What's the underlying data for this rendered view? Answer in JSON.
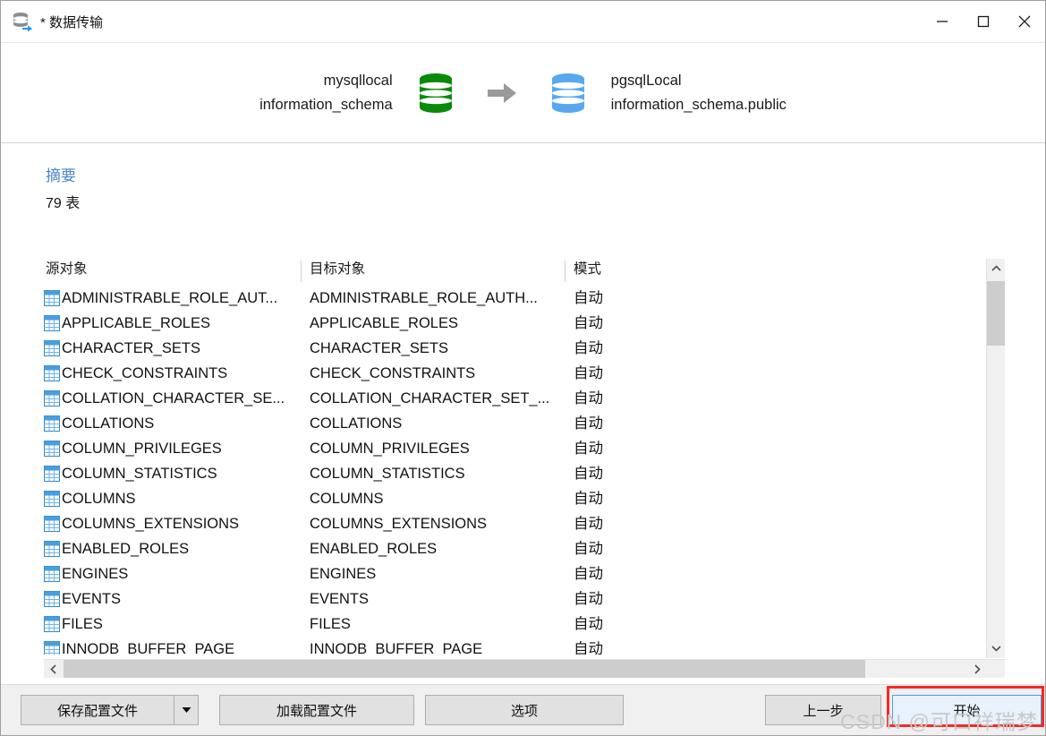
{
  "window": {
    "title": "* 数据传输",
    "icon": "database-transfer-icon",
    "controls": {
      "minimize": "minimize-icon",
      "maximize": "maximize-icon",
      "close": "close-icon"
    }
  },
  "transfer": {
    "source": {
      "connection": "mysqllocal",
      "schema": "information_schema",
      "icon": "database-green-icon",
      "color": "#0a8a0a"
    },
    "arrow": "arrow-right-icon",
    "target": {
      "connection": "pgsqlLocal",
      "schema": "information_schema.public",
      "icon": "database-blue-icon",
      "color": "#58a8f0"
    }
  },
  "summary": {
    "title": "摘要",
    "title_color": "#4a86c8",
    "count": "79 表"
  },
  "table": {
    "columns": [
      "源对象",
      "目标对象",
      "模式"
    ],
    "rows": [
      {
        "source": "ADMINISTRABLE_ROLE_AUT...",
        "target": "ADMINISTRABLE_ROLE_AUTH...",
        "mode": "自动"
      },
      {
        "source": "APPLICABLE_ROLES",
        "target": "APPLICABLE_ROLES",
        "mode": "自动"
      },
      {
        "source": "CHARACTER_SETS",
        "target": "CHARACTER_SETS",
        "mode": "自动"
      },
      {
        "source": "CHECK_CONSTRAINTS",
        "target": "CHECK_CONSTRAINTS",
        "mode": "自动"
      },
      {
        "source": "COLLATION_CHARACTER_SE...",
        "target": "COLLATION_CHARACTER_SET_...",
        "mode": "自动"
      },
      {
        "source": "COLLATIONS",
        "target": "COLLATIONS",
        "mode": "自动"
      },
      {
        "source": "COLUMN_PRIVILEGES",
        "target": "COLUMN_PRIVILEGES",
        "mode": "自动"
      },
      {
        "source": "COLUMN_STATISTICS",
        "target": "COLUMN_STATISTICS",
        "mode": "自动"
      },
      {
        "source": "COLUMNS",
        "target": "COLUMNS",
        "mode": "自动"
      },
      {
        "source": "COLUMNS_EXTENSIONS",
        "target": "COLUMNS_EXTENSIONS",
        "mode": "自动"
      },
      {
        "source": "ENABLED_ROLES",
        "target": "ENABLED_ROLES",
        "mode": "自动"
      },
      {
        "source": "ENGINES",
        "target": "ENGINES",
        "mode": "自动"
      },
      {
        "source": "EVENTS",
        "target": "EVENTS",
        "mode": "自动"
      },
      {
        "source": "FILES",
        "target": "FILES",
        "mode": "自动"
      },
      {
        "source": "INNODB_BUFFER_PAGE",
        "target": "INNODB_BUFFER_PAGE",
        "mode": "自动"
      }
    ]
  },
  "footer": {
    "save_profile": "保存配置文件",
    "save_profile_dropdown": "chevron-down-icon",
    "load_profile": "加载配置文件",
    "options": "选项",
    "previous": "上一步",
    "start": "开始",
    "start_highlight_color": "#f42a24"
  },
  "watermark": "CSDN @可口祥瑞梦"
}
